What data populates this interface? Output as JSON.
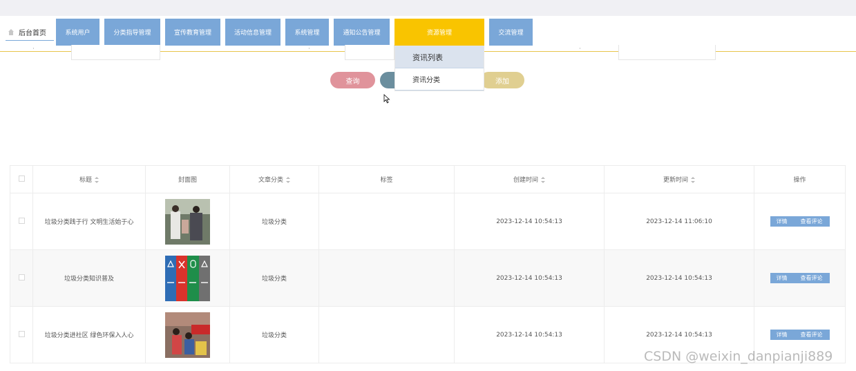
{
  "nav": {
    "home_label": "后台首页",
    "items": [
      {
        "label": "系统用户"
      },
      {
        "label": "分类指导管理"
      },
      {
        "label": "宣传教育管理"
      },
      {
        "label": "活动信息管理"
      },
      {
        "label": "系统管理"
      },
      {
        "label": "通知公告管理"
      },
      {
        "label": "资源管理"
      },
      {
        "label": "交流管理"
      }
    ],
    "active_color": "#f9c400",
    "menu_color": "#7aa7d8"
  },
  "dropdown": {
    "items": [
      {
        "label": "资讯列表"
      },
      {
        "label": "资讯分类"
      }
    ]
  },
  "buttons": {
    "query": "查询",
    "add": "添加",
    "query_color": "#e0939b",
    "reset_color": "#6b8e9e",
    "add_color": "#e0cf91"
  },
  "table": {
    "headers": [
      "标题",
      "封面图",
      "文章分类",
      "标签",
      "创建时间",
      "更新时间",
      "操作"
    ],
    "rows": [
      {
        "title": "垃圾分类践于行 文明生活始于心",
        "category": "垃圾分类",
        "tag": "",
        "created": "2023-12-14 10:54:13",
        "updated": "2023-12-14 11:06:10"
      },
      {
        "title": "垃圾分类知识普及",
        "category": "垃圾分类",
        "tag": "",
        "created": "2023-12-14 10:54:13",
        "updated": "2023-12-14 10:54:13"
      },
      {
        "title": "垃圾分类进社区 绿色环保入人心",
        "category": "垃圾分类",
        "tag": "",
        "created": "2023-12-14 10:54:13",
        "updated": "2023-12-14 10:54:13"
      }
    ],
    "actions": {
      "detail": "详情",
      "comments": "查看评论"
    }
  },
  "watermark": "CSDN @weixin_danpianji889"
}
